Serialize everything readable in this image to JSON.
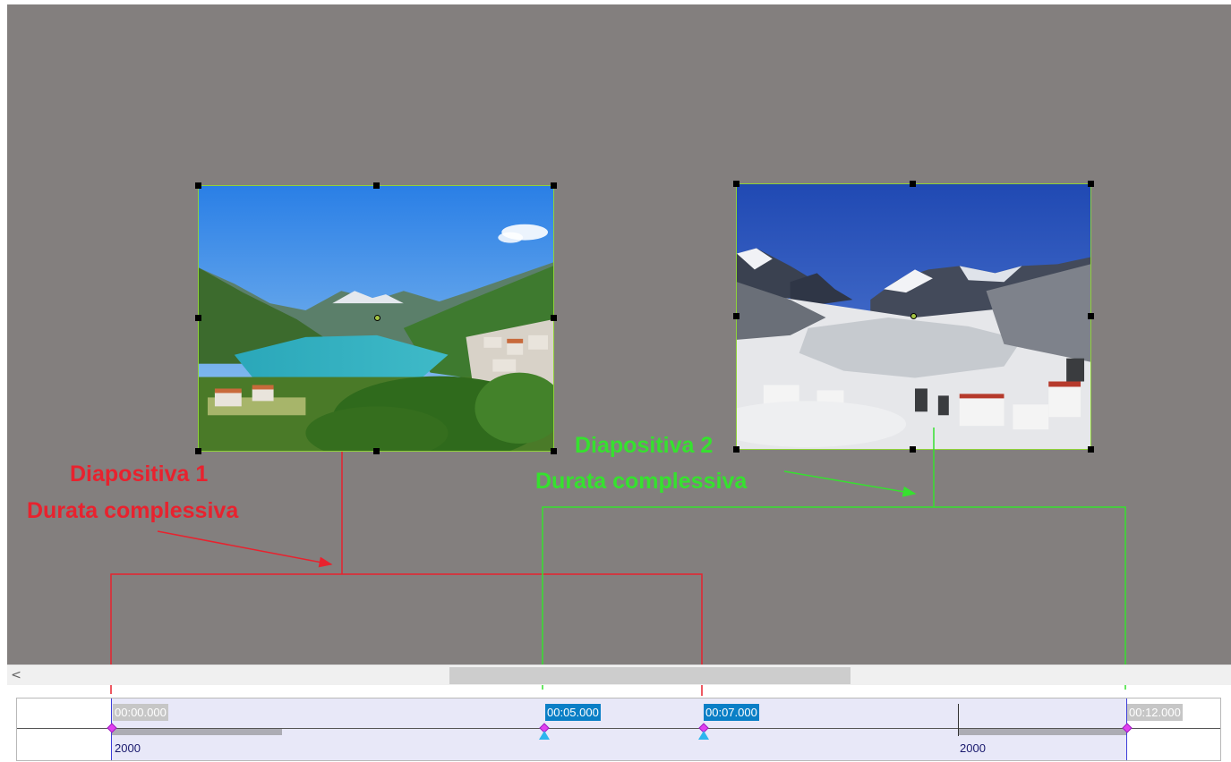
{
  "annotations": {
    "slide1_title": "Diapositiva 1",
    "slide1_sub": "Durata complessiva",
    "slide2_title": "Diapositiva 2",
    "slide2_sub": "Durata complessiva",
    "slide1_color": "#e8222e",
    "slide2_color": "#36e12f"
  },
  "scrollbar": {
    "left_arrow": "<"
  },
  "timeline": {
    "labels": {
      "t0": "00:00.000",
      "t5": "00:05.000",
      "t7": "00:07.000",
      "t12": "00:12.000"
    },
    "durations": {
      "start": "2000",
      "end": "2000"
    }
  },
  "icons": {
    "handle": "selection-handle-icon",
    "keyframe": "diamond-keyframe-icon",
    "transition": "triangle-marker-icon"
  },
  "colors": {
    "stage": "#837f7e",
    "selection": "#8fd23a",
    "time_label_active": "#0a7fc6",
    "keyframe": "#e13ff0"
  }
}
